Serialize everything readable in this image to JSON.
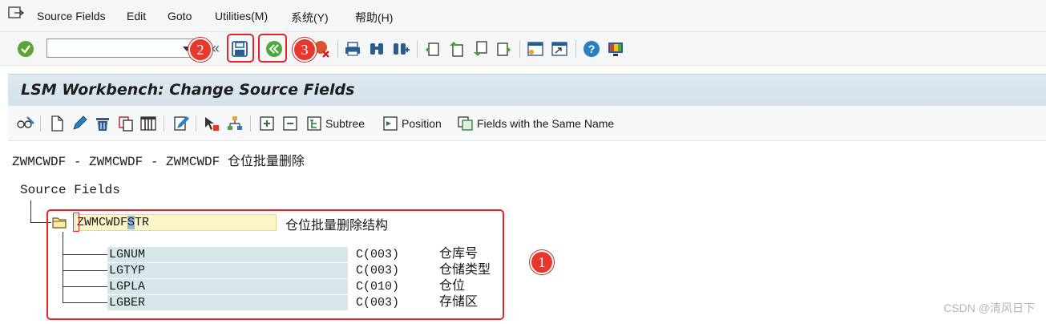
{
  "menubar": {
    "items": [
      {
        "label": "Source Fields",
        "underline": "S"
      },
      {
        "label": "Edit",
        "underline": "E"
      },
      {
        "label": "Goto",
        "underline": "G"
      },
      {
        "label": "Utilities(M)"
      },
      {
        "label": "系统(Y)"
      },
      {
        "label": "帮助(H)"
      }
    ]
  },
  "toolbar": {
    "command_value": "",
    "double_arrow": "«",
    "callouts": [
      "2",
      "3"
    ]
  },
  "title": {
    "text": "LSM Workbench: Change Source Fields"
  },
  "app_toolbar": {
    "subtree_label": "Subtree",
    "position_label": "Position",
    "same_name_label": "Fields with the Same Name"
  },
  "content": {
    "header_line": "ZWMCWDF - ZWMCWDF - ZWMCWDF 仓位批量删除",
    "tree_root": "Source Fields",
    "structure": {
      "name_prefix": "ZWMCWDF",
      "name_selected": "S",
      "name_suffix": "TR",
      "description": "仓位批量删除结构"
    },
    "fields": [
      {
        "name": "LGNUM",
        "type": "C(003)",
        "description": "仓库号"
      },
      {
        "name": "LGTYP",
        "type": "C(003)",
        "description": "仓储类型"
      },
      {
        "name": "LGPLA",
        "type": "C(010)",
        "description": "仓位"
      },
      {
        "name": "LGBER",
        "type": "C(003)",
        "description": "存储区"
      }
    ],
    "callout": "1"
  },
  "watermark": "CSDN @清风日下",
  "colors": {
    "highlight": "#e8232b",
    "callout": "#e8372c",
    "title_bg": "#d9e4ed",
    "structure_field_bg": "#fbf6c8",
    "field_bg": "#d7e6e8"
  }
}
